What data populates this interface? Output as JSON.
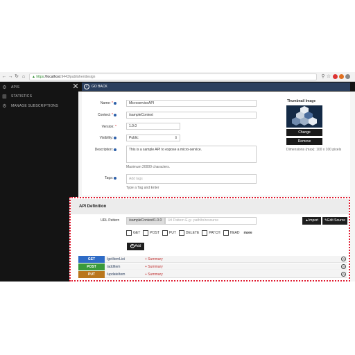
{
  "browser": {
    "url_https": "https",
    "url_host": "://localhost",
    "url_path": ":9443/publisher/design"
  },
  "sidebar": {
    "items": [
      {
        "label": "APIS",
        "icon": "gear-icon"
      },
      {
        "label": "STATISTICS",
        "icon": "chart-icon"
      },
      {
        "label": "MANAGE SUBSCRIPTIONS",
        "icon": "gear-icon"
      }
    ]
  },
  "header": {
    "go_back": "GO BACK"
  },
  "form": {
    "name_label": "Name:",
    "name_value": "MicroserviceAPI",
    "context_label": "Context:",
    "context_value": "/sampleContext",
    "version_label": "Version:",
    "version_value": "1.0.0",
    "visibility_label": "Visibility:",
    "visibility_value": "Public",
    "description_label": "Description:",
    "description_value": "This is a sample API to expose a micro-service.",
    "description_hint": "Maximum 20000 characters.",
    "tags_label": "Tags:",
    "tags_placeholder": "Add tags",
    "tags_hint": "Type a Tag and Enter"
  },
  "thumbnail": {
    "title": "Thumbnail Image",
    "change": "Change",
    "remove": "Remove",
    "dimensions": "Dimensions (max): 100 x 100 pixels"
  },
  "api_definition": {
    "title": "API Definition",
    "url_pattern_label": "URL Pattern",
    "context_prefix": "/sampleContext/1.0.0",
    "pattern_placeholder": "Url Pattern E.g.: path/to/resource",
    "import": "Import",
    "edit_source": "Edit Source",
    "verbs": [
      "GET",
      "POST",
      "PUT",
      "DELETE",
      "PATCH",
      "HEAD"
    ],
    "more": "more",
    "add": "Add",
    "resources": [
      {
        "method": "GET",
        "color": "#2e6bc6",
        "path": "/getItemList",
        "summary": "+ Summary"
      },
      {
        "method": "POST",
        "color": "#3a9a3a",
        "path": "/addItem",
        "summary": "+ Summary"
      },
      {
        "method": "PUT",
        "color": "#b9761c",
        "path": "/updateItem",
        "summary": "+ Summary"
      }
    ]
  },
  "colors": {
    "highlight_border": "#e01a2f",
    "go_back_bar": "#2b3f5e"
  }
}
